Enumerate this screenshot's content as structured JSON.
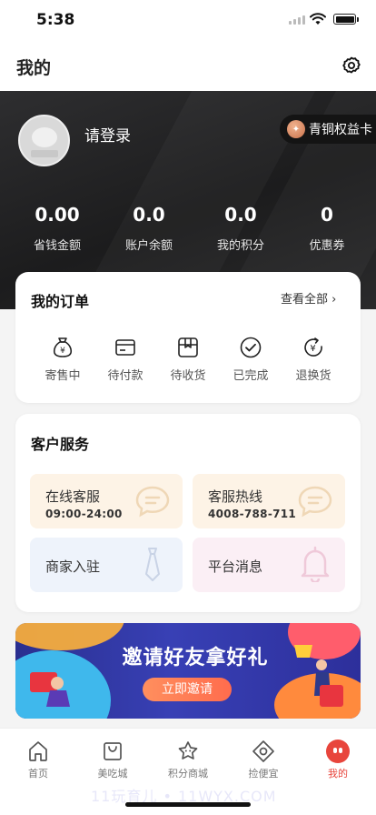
{
  "status": {
    "time": "5:38"
  },
  "header": {
    "title": "我的"
  },
  "profile": {
    "login_label": "请登录",
    "vip_label": "青铜权益卡"
  },
  "stats": [
    {
      "value": "0.00",
      "label": "省钱金额"
    },
    {
      "value": "0.0",
      "label": "账户余额"
    },
    {
      "value": "0.0",
      "label": "我的积分"
    },
    {
      "value": "0",
      "label": "优惠券"
    }
  ],
  "orders": {
    "title": "我的订单",
    "view_all": "查看全部 ›",
    "items": [
      {
        "label": "寄售中",
        "icon": "money-bag-icon"
      },
      {
        "label": "待付款",
        "icon": "wallet-card-icon"
      },
      {
        "label": "待收货",
        "icon": "package-box-icon"
      },
      {
        "label": "已完成",
        "icon": "check-circle-icon"
      },
      {
        "label": "退换货",
        "icon": "yen-refresh-icon"
      }
    ]
  },
  "service": {
    "title": "客户服务",
    "tiles": [
      {
        "title": "在线客服",
        "subtitle": "09:00-24:00",
        "icon": "chat-bubble-icon",
        "bg": "#fdf3e6"
      },
      {
        "title": "客服热线",
        "subtitle": "4008-788-711",
        "icon": "chat-bubble-icon",
        "bg": "#fdf3e6"
      },
      {
        "title": "商家入驻",
        "icon": "tie-icon",
        "bg": "#eef3fb"
      },
      {
        "title": "平台消息",
        "icon": "bell-icon",
        "bg": "#fbeff5"
      }
    ]
  },
  "banner": {
    "headline": "邀请好友拿好礼",
    "cta": "立即邀请"
  },
  "tabs": [
    {
      "label": "首页",
      "icon": "home-icon"
    },
    {
      "label": "美吃城",
      "icon": "shopping-bag-icon"
    },
    {
      "label": "积分商城",
      "icon": "star-face-icon"
    },
    {
      "label": "捡便宜",
      "icon": "diamond-icon"
    },
    {
      "label": "我的",
      "icon": "profile-face-icon",
      "active": true
    }
  ],
  "watermark": "11玩育儿 • 11WYX.COM",
  "colors": {
    "accent": "#e8453c",
    "hero_bg": "#242425",
    "vip_bg": "#141414"
  }
}
